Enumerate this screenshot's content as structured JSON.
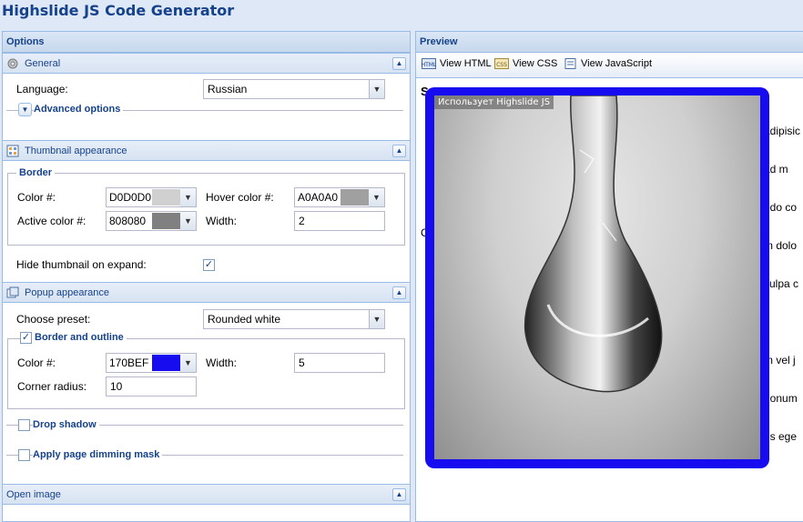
{
  "app": {
    "title": "Highslide JS Code Generator"
  },
  "options": {
    "header": "Options",
    "general": {
      "title": "General",
      "language_label": "Language:",
      "language_value": "Russian",
      "advanced_label": "Advanced options"
    },
    "thumbnail": {
      "title": "Thumbnail appearance",
      "border_legend": "Border",
      "color_label": "Color #:",
      "color_value": "D0D0D0",
      "color_swatch": "#d0d0d0",
      "hover_label": "Hover color #:",
      "hover_value": "A0A0A0",
      "hover_swatch": "#a0a0a0",
      "active_label": "Active color #:",
      "active_value": "808080",
      "active_swatch": "#808080",
      "width_label": "Width:",
      "width_value": "2",
      "hide_label": "Hide thumbnail on expand:",
      "hide_checked": true
    },
    "popup": {
      "title": "Popup appearance",
      "preset_label": "Choose preset:",
      "preset_value": "Rounded white",
      "border_legend": "Border and outline",
      "border_checked": true,
      "color_label": "Color #:",
      "color_value": "170BEF",
      "color_swatch": "#170bef",
      "width_label": "Width:",
      "width_value": "5",
      "corner_label": "Corner radius:",
      "corner_value": "10",
      "drop_shadow_label": "Drop shadow",
      "dimming_label": "Apply page dimming mask"
    },
    "open_image": {
      "title": "Open image"
    }
  },
  "preview": {
    "header": "Preview",
    "toolbar": {
      "view_html": "View HTML",
      "view_css": "View CSS",
      "view_js": "View JavaScript"
    },
    "caption": "Использует Highslide JS",
    "bg_text_lines": [
      "adipisic",
      "ad m",
      "odo co",
      "m dolo",
      "culpa c",
      "",
      "m vel j",
      "nonum",
      "us ege"
    ],
    "frame_color": "#170bef"
  }
}
